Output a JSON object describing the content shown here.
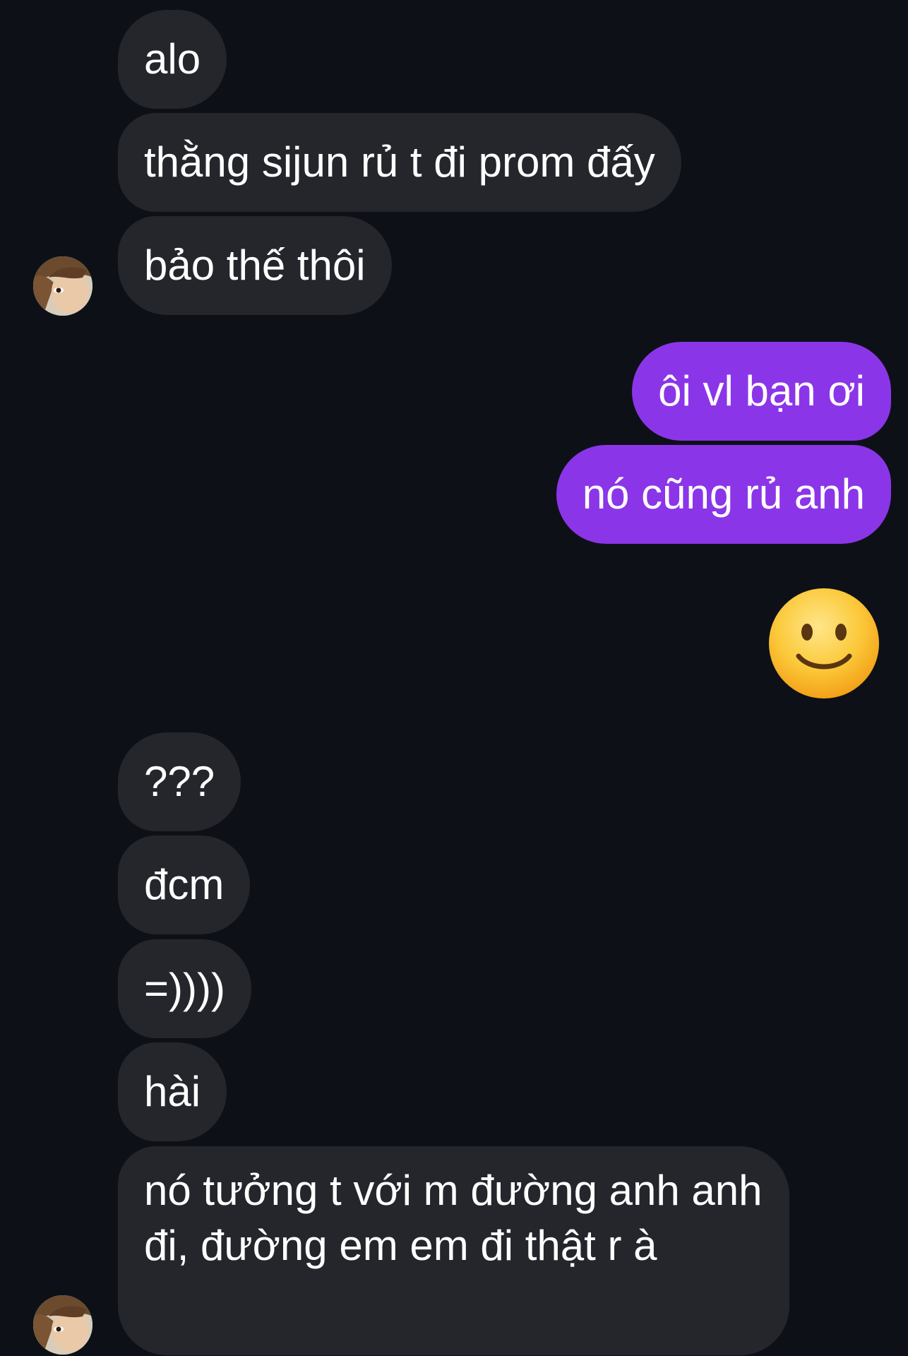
{
  "colors": {
    "background": "#0d1117",
    "incoming_bubble": "#24262c",
    "outgoing_bubble": "#8b35e8",
    "text": "#ffffff"
  },
  "messages": {
    "group1": [
      "alo",
      "thằng sijun rủ t đi prom đấy",
      "bảo thế thôi"
    ],
    "group2": [
      "ôi vl bạn ơi",
      "nó cũng rủ anh"
    ],
    "reaction_emoji": "smiling-face-emoji",
    "group3": [
      "???",
      "đcm",
      "=))))",
      "hài",
      "nó tưởng t với m đường anh anh đi, đường em em đi thật r à"
    ]
  },
  "avatar": {
    "icon": "contact-avatar-photo"
  }
}
